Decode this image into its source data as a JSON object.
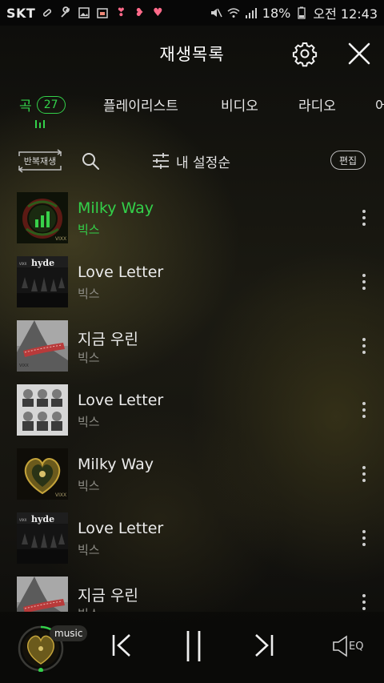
{
  "status_bar": {
    "carrier": "SKT",
    "battery": "18%",
    "time": "오전 12:43"
  },
  "header": {
    "title": "재생목록"
  },
  "tabs": [
    {
      "label": "곡",
      "count": "27",
      "active": true
    },
    {
      "label": "플레이리스트"
    },
    {
      "label": "비디오"
    },
    {
      "label": "라디오"
    },
    {
      "label": "어"
    }
  ],
  "toolbar": {
    "repeat_label": "반복재생",
    "sort_label": "내 설정순",
    "edit_label": "편집"
  },
  "tracks": [
    {
      "title": "Milky Way",
      "artist": "빅스",
      "active": true,
      "art": "milky"
    },
    {
      "title": "Love Letter",
      "artist": "빅스",
      "art": "hyde"
    },
    {
      "title": "지금 우린",
      "artist": "빅스",
      "art": "now"
    },
    {
      "title": "Love Letter",
      "artist": "빅스",
      "art": "group"
    },
    {
      "title": "Milky Way",
      "artist": "빅스",
      "art": "milky2"
    },
    {
      "title": "Love Letter",
      "artist": "빅스",
      "art": "hyde"
    },
    {
      "title": "지금 우린",
      "artist": "빅스",
      "art": "now"
    }
  ],
  "player": {
    "source_badge": "music",
    "eq_label": "EQ"
  },
  "colors": {
    "accent": "#33d14a",
    "artist_gray": "#8e8d86"
  }
}
